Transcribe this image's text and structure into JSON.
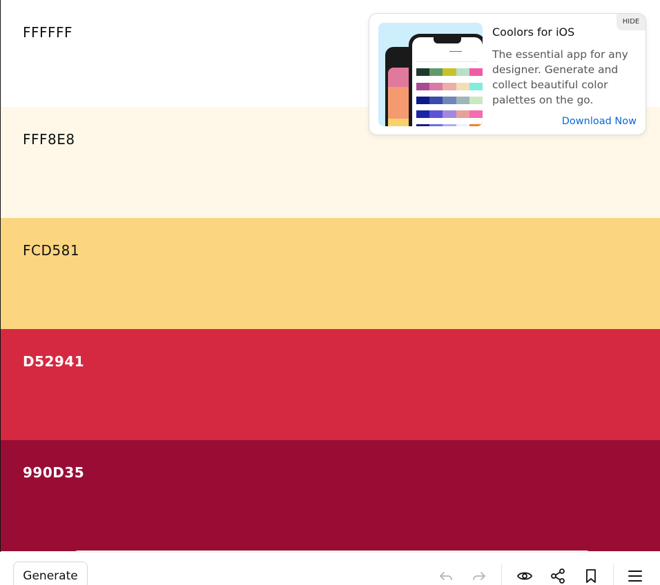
{
  "palette": {
    "swatches": [
      {
        "hex": "FFFFFF",
        "color": "#FFFFFF",
        "text_color": "#111111"
      },
      {
        "hex": "FFF8E8",
        "color": "#FFF8E8",
        "text_color": "#111111"
      },
      {
        "hex": "FCD581",
        "color": "#FCD581",
        "text_color": "#111111"
      },
      {
        "hex": "D52941",
        "color": "#D52941",
        "text_color": "#FFFFFF"
      },
      {
        "hex": "990D35",
        "color": "#990D35",
        "text_color": "#FFFFFF"
      }
    ]
  },
  "ad": {
    "hide_label": "HIDE",
    "title": "Coolors for iOS",
    "description": "The essential app for any designer. Generate and collect beautiful color palettes on the go.",
    "cta": "Download Now",
    "cta_color": "#0A66D8"
  },
  "toolbar": {
    "generate_label": "Generate",
    "icons": [
      "undo-icon",
      "redo-icon",
      "eye-icon",
      "share-icon",
      "bookmark-icon",
      "menu-icon"
    ]
  }
}
